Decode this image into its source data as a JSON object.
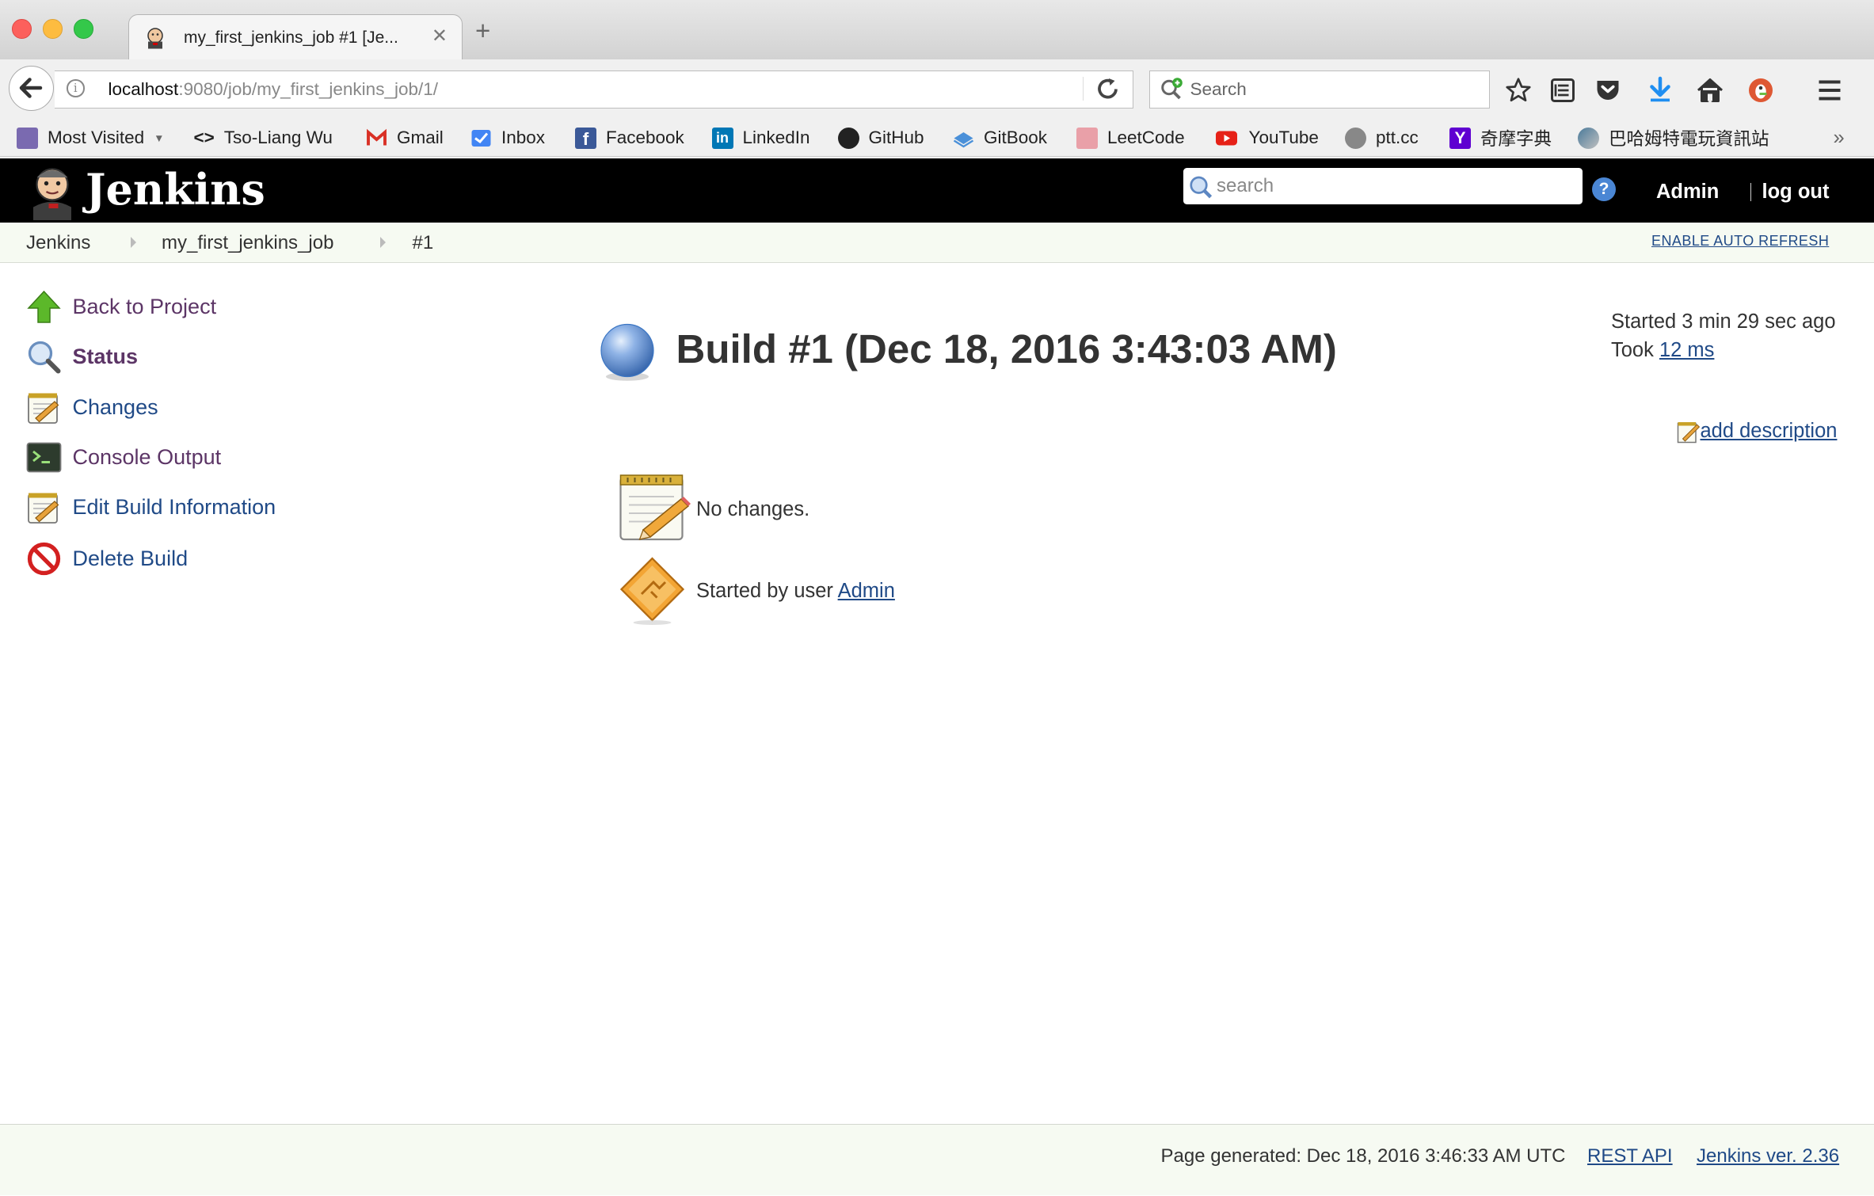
{
  "browser": {
    "tab_title": "my_first_jenkins_job #1 [Je...",
    "url_host": "localhost",
    "url_rest": ":9080/job/my_first_jenkins_job/1/",
    "search_placeholder": "Search"
  },
  "bookmarks": [
    {
      "label": "Most Visited",
      "icon": "most-visited-icon"
    },
    {
      "label": "Tso-Liang Wu",
      "icon": "code-icon"
    },
    {
      "label": "Gmail",
      "icon": "gmail-icon"
    },
    {
      "label": "Inbox",
      "icon": "inbox-icon"
    },
    {
      "label": "Facebook",
      "icon": "facebook-icon"
    },
    {
      "label": "LinkedIn",
      "icon": "linkedin-icon"
    },
    {
      "label": "GitHub",
      "icon": "github-icon"
    },
    {
      "label": "GitBook",
      "icon": "gitbook-icon"
    },
    {
      "label": "LeetCode",
      "icon": "leetcode-icon"
    },
    {
      "label": "YouTube",
      "icon": "youtube-icon"
    },
    {
      "label": "ptt.cc",
      "icon": "globe-icon"
    },
    {
      "label": "奇摩字典",
      "icon": "yahoo-icon"
    },
    {
      "label": "巴哈姆特電玩資訊站",
      "icon": "bahamut-icon"
    }
  ],
  "jenkins": {
    "brand": "Jenkins",
    "search_placeholder": "search",
    "user": "Admin",
    "logout": "log out"
  },
  "breadcrumb": {
    "items": [
      "Jenkins",
      "my_first_jenkins_job",
      "#1"
    ],
    "auto_refresh": "ENABLE AUTO REFRESH"
  },
  "side_panel": [
    {
      "label": "Back to Project",
      "icon": "up-arrow-icon"
    },
    {
      "label": "Status",
      "icon": "magnifier-icon"
    },
    {
      "label": "Changes",
      "icon": "notepad-icon"
    },
    {
      "label": "Console Output",
      "icon": "terminal-icon"
    },
    {
      "label": "Edit Build Information",
      "icon": "notepad-icon"
    },
    {
      "label": "Delete Build",
      "icon": "no-entry-icon"
    }
  ],
  "build": {
    "title": "Build #1 (Dec 18, 2016 3:43:03 AM)",
    "started": "Started 3 min 29 sec ago",
    "took_prefix": "Took",
    "took_value": "12 ms",
    "add_description": "add description",
    "no_changes": "No changes.",
    "started_by_prefix": "Started by user",
    "started_by_user": "Admin",
    "status_color": "#3b76c4"
  },
  "footer": {
    "page_generated": "Page generated: Dec 18, 2016 3:46:33 AM UTC",
    "rest_api": "REST API",
    "version": "Jenkins ver. 2.36"
  }
}
